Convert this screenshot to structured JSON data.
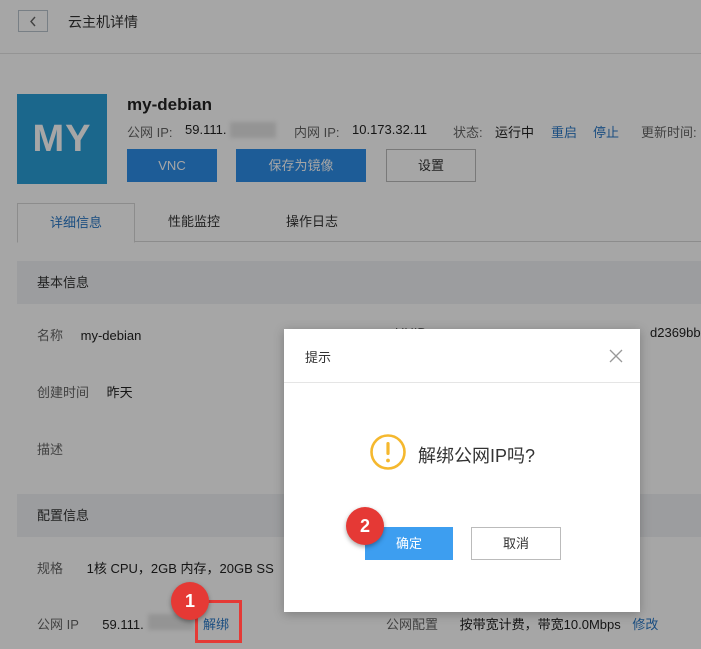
{
  "header": {
    "title": "云主机详情"
  },
  "host": {
    "avatar_text": "MY",
    "name": "my-debian",
    "public_ip_label": "公网 IP:",
    "public_ip_value": "59.111.",
    "private_ip_label": "内网 IP:",
    "private_ip_value": "10.173.32.11",
    "status_label": "状态:",
    "status_value": "运行中",
    "restart_label": "重启",
    "stop_label": "停止",
    "updated_label": "更新时间:"
  },
  "actions": {
    "vnc": "VNC",
    "save_image": "保存为镜像",
    "settings": "设置"
  },
  "tabs": [
    "详细信息",
    "性能监控",
    "操作日志"
  ],
  "basic_info": {
    "heading": "基本信息",
    "name_label": "名称",
    "name_value": "my-debian",
    "uuid_label": "UUID",
    "uuid_value_partial": "d2369bb",
    "created_label": "创建时间",
    "created_value": "昨天",
    "desc_label": "描述"
  },
  "config_info": {
    "heading": "配置信息",
    "spec_label": "规格",
    "spec_value": "1核 CPU，2GB 内存，20GB SS",
    "public_ip_label": "公网 IP",
    "public_ip_value": "59.111.",
    "unbind_label": "解绑",
    "public_config_label": "公网配置",
    "public_config_value": "按带宽计费，带宽10.0Mbps",
    "modify_label": "修改"
  },
  "dialog": {
    "title": "提示",
    "message": "解绑公网IP吗?",
    "confirm": "确定",
    "cancel": "取消"
  },
  "markers": {
    "first": "1",
    "second": "2"
  },
  "colors": {
    "accent": "#2d8ee8",
    "link": "#2a78c6",
    "avatar": "#2a9fd8",
    "marker": "#e53935",
    "warning": "#f5b82e"
  }
}
